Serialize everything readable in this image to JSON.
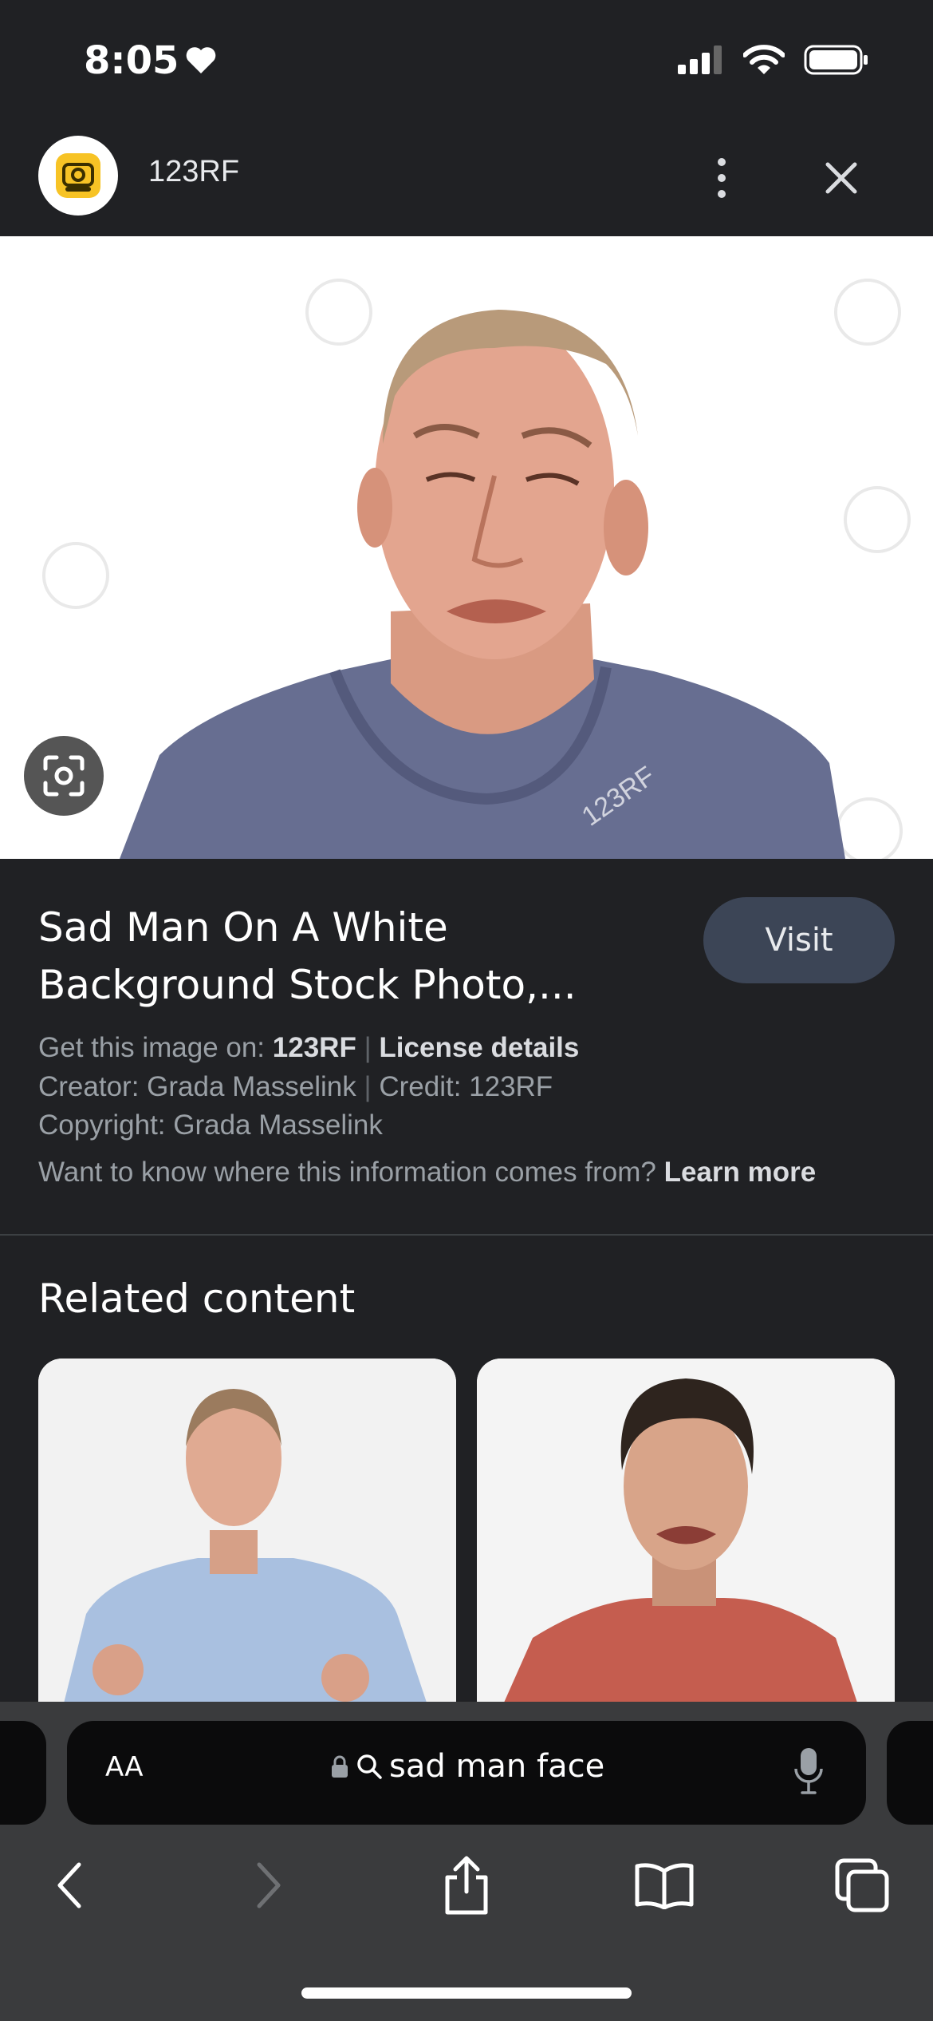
{
  "status_bar": {
    "time": "8:05",
    "icons": [
      "heart-icon",
      "cellular-signal-icon",
      "wifi-icon",
      "battery-icon"
    ]
  },
  "source": {
    "name": "123RF",
    "icons": [
      "123rf-logo-icon",
      "more-vertical-icon",
      "close-icon"
    ]
  },
  "image": {
    "subject": "Bald middle-aged man in a grey t-shirt making a crying face",
    "watermark": "123RF",
    "lens_icon": "google-lens-icon"
  },
  "details": {
    "title": "Sad Man On A White Background Stock Photo,...",
    "visit_label": "Visit",
    "get_image_label": "Get this image on:",
    "get_image_source": "123RF",
    "license_label": "License details",
    "creator_line": "Creator: Grada Masselink",
    "credit_line": "Credit: 123RF",
    "copyright_line": "Copyright: Grada Masselink",
    "info_question": "Want to know where this information comes from?",
    "learn_more_label": "Learn more"
  },
  "related": {
    "title": "Related content",
    "items": [
      {
        "description": "Balding man in a light blue shirt with clenched fists"
      },
      {
        "description": "Dark-haired man in a red t-shirt crying"
      }
    ]
  },
  "browser": {
    "aa_label": "AA",
    "search_text": "sad man face",
    "icons": [
      "lock-icon",
      "search-icon",
      "microphone-icon",
      "back-icon",
      "forward-icon",
      "share-icon",
      "bookmarks-icon",
      "tabs-icon"
    ]
  },
  "colors": {
    "background": "#202124",
    "visit_button": "#3c4556",
    "toolbar": "#3a3b3d",
    "address_bar": "#0b0b0c"
  }
}
